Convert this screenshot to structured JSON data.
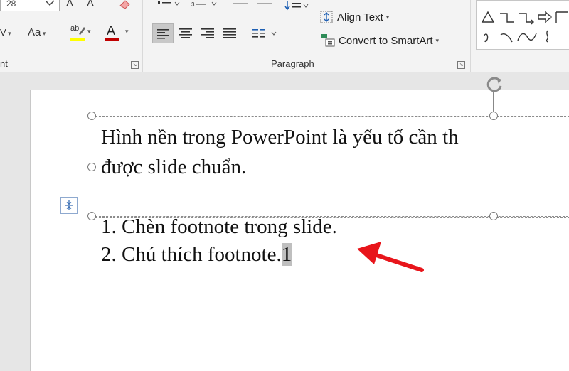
{
  "ribbon": {
    "font_size_value": "28",
    "paragraph_group_label": "Paragraph",
    "font_group_label_partial": "nt",
    "align_text_label": "Align Text",
    "convert_smartart_label": "Convert to SmartArt",
    "change_case_label": "Aa",
    "highlight_label": "ab",
    "font_color_label": "A"
  },
  "slide": {
    "paragraph_line1": "Hình nền trong PowerPoint là yếu tố cần th",
    "paragraph_line2": "được slide chuẩn.",
    "list_item_1": "1. Chèn footnote trong slide.",
    "list_item_2_text": "2. Chú thích footnote.",
    "footnote_marker": "1"
  },
  "colors": {
    "highlight_bar": "#ffff00",
    "font_color_bar": "#c00000",
    "arrow": "#e8151b",
    "selection_gray": "#bfbfbf"
  }
}
